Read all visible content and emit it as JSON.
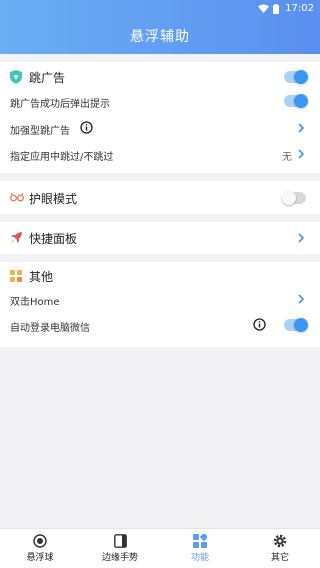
{
  "status": {
    "time": "17:02"
  },
  "header": {
    "title": "悬浮辅助"
  },
  "skip_ads": {
    "title": "跳广告",
    "rows": [
      {
        "label": "跳广告成功后弹出提示"
      },
      {
        "label": "加强型跳广告"
      },
      {
        "label": "指定应用中跳过/不跳过",
        "value": "无"
      }
    ]
  },
  "eye_mode": {
    "title": "护眼模式"
  },
  "quick_panel": {
    "title": "快捷面板"
  },
  "others": {
    "title": "其他",
    "rows": [
      {
        "label": "双击Home"
      },
      {
        "label": "自动登录电脑微信"
      }
    ]
  },
  "tabs": [
    {
      "label": "悬浮球",
      "icon": "record-icon"
    },
    {
      "label": "边缘手势",
      "icon": "edge-panel-icon"
    },
    {
      "label": "功能",
      "icon": "apps-grid-icon"
    },
    {
      "label": "其它",
      "icon": "gear-icon"
    }
  ],
  "colors": {
    "accent": "#3a97f0",
    "header_start": "#6aaef3",
    "header_end": "#5b8ff0"
  }
}
